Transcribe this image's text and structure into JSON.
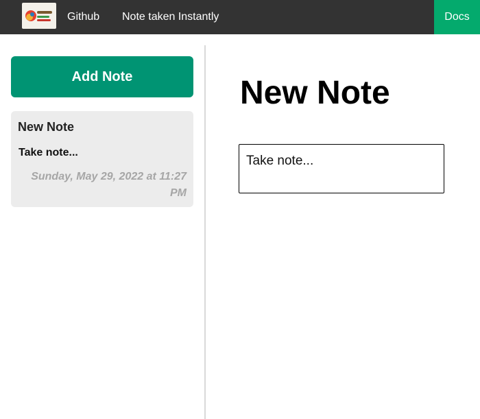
{
  "header": {
    "logo_icon": "simple-notes-logo-icon",
    "links": {
      "github": "Github",
      "instant": "Note taken Instantly",
      "docs": "Docs"
    },
    "colors": {
      "bar": "#333333",
      "docs_bg": "#04aa6d"
    }
  },
  "sidebar": {
    "add_button_label": "Add Note",
    "add_button_color": "#009473",
    "notes": [
      {
        "title": "New Note",
        "body": "Take note...",
        "date": "Sunday, May 29, 2022 at 11:27 PM"
      }
    ]
  },
  "main": {
    "title": "New Note",
    "editor_placeholder": "Take note..."
  }
}
